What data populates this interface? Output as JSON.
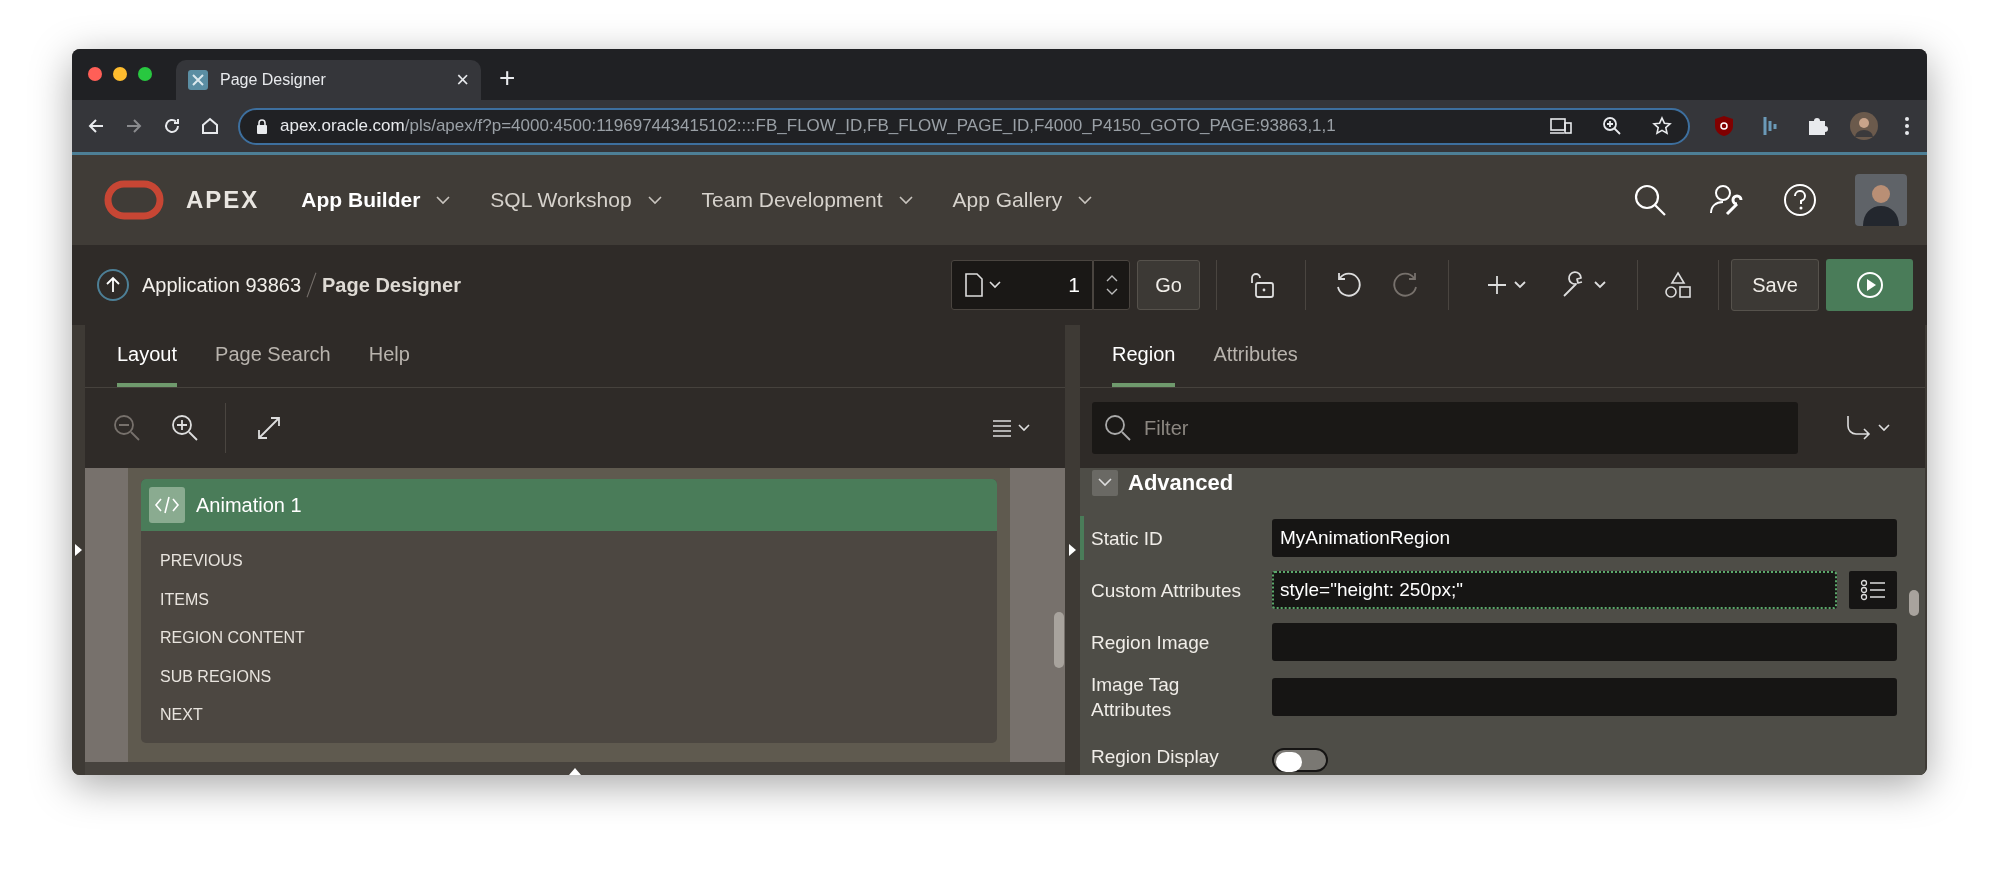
{
  "browser": {
    "tab_title": "Page Designer",
    "tab_close": "×",
    "new_tab": "+",
    "url_host": "apex.oracle.com",
    "url_path": "/pls/apex/f?p=4000:4500:119697443415102::::FB_FLOW_ID,FB_FLOW_PAGE_ID,F4000_P4150_GOTO_PAGE:93863,1,1"
  },
  "header": {
    "logo_text": "APEX",
    "nav": [
      {
        "label": "App Builder",
        "selected": true
      },
      {
        "label": "SQL Workshop",
        "selected": false
      },
      {
        "label": "Team Development",
        "selected": false
      },
      {
        "label": "App Gallery",
        "selected": false
      }
    ]
  },
  "breadcrumb": {
    "parent": "Application 93863",
    "current": "Page Designer"
  },
  "toolbar": {
    "page_number": "1",
    "go": "Go",
    "save": "Save"
  },
  "left_panel": {
    "tabs": [
      {
        "label": "Layout",
        "selected": true
      },
      {
        "label": "Page Search",
        "selected": false
      },
      {
        "label": "Help",
        "selected": false
      }
    ],
    "region": {
      "title": "Animation 1",
      "positions": [
        "PREVIOUS",
        "ITEMS",
        "REGION CONTENT",
        "SUB REGIONS",
        "NEXT"
      ]
    }
  },
  "right_panel": {
    "tabs": [
      {
        "label": "Region",
        "selected": true
      },
      {
        "label": "Attributes",
        "selected": false
      }
    ],
    "filter_placeholder": "Filter",
    "section": {
      "title": "Advanced",
      "expanded": true,
      "fields": [
        {
          "label": "Static ID",
          "kind": "text",
          "value": "MyAnimationRegion",
          "current": true,
          "focused": false
        },
        {
          "label": "Custom Attributes",
          "kind": "text_with_button",
          "value": "style=\"height: 250px;\"",
          "current": false,
          "focused": true
        },
        {
          "label": "Region Image",
          "kind": "text",
          "current": false,
          "focused": false
        },
        {
          "label": "Image Tag Attributes",
          "kind": "text",
          "current": false,
          "focused": false
        },
        {
          "label": "Region Display",
          "kind": "switch",
          "on": false,
          "current": false,
          "focused": false
        }
      ]
    }
  }
}
